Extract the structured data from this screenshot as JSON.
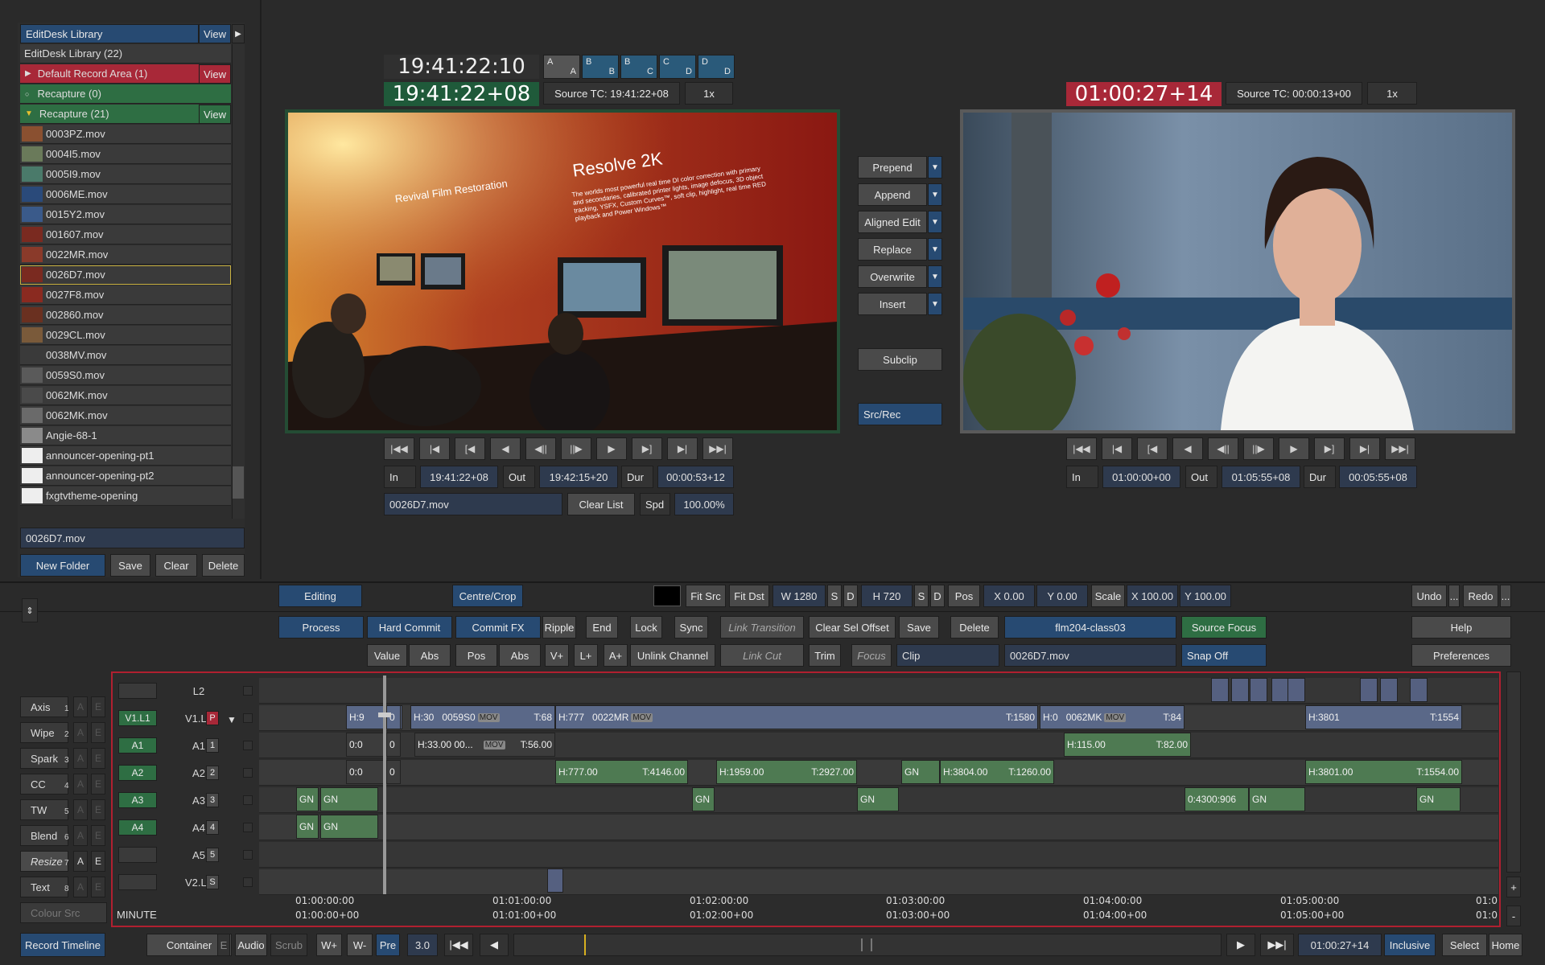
{
  "library": {
    "header": "EditDesk Library",
    "view_label": "View",
    "count_label": "EditDesk Library (22)",
    "default_record": "Default Record Area (1)",
    "recapture_0": "Recapture (0)",
    "recapture_21": "Recapture (21)",
    "items": [
      "0003PZ.mov",
      "0004I5.mov",
      "0005I9.mov",
      "0006ME.mov",
      "0015Y2.mov",
      "001607.mov",
      "0022MR.mov",
      "0026D7.mov",
      "0027F8.mov",
      "002860.mov",
      "0029CL.mov",
      "0038MV.mov",
      "0059S0.mov",
      "0062MK.mov",
      "0062MK.mov",
      "Angie-68-1",
      "announcer-opening-pt1",
      "announcer-opening-pt2",
      "fxgtvtheme-opening"
    ],
    "selected_name": "0026D7.mov",
    "buttons": {
      "new_folder": "New Folder",
      "save": "Save",
      "clear": "Clear",
      "delete": "Delete"
    }
  },
  "source": {
    "tc_top": "19:41:22:10",
    "tc_main": "19:41:22+08",
    "source_tc": "Source TC: 19:41:22+08",
    "speed": "1x",
    "tabs": [
      [
        "A",
        "A"
      ],
      [
        "B",
        "B"
      ],
      [
        "B",
        "C"
      ],
      [
        "C",
        "D"
      ],
      [
        "D",
        "D"
      ]
    ],
    "in_label": "In",
    "in_value": "19:41:22+08",
    "out_label": "Out",
    "out_value": "19:42:15+20",
    "dur_label": "Dur",
    "dur_value": "00:00:53+12",
    "clip_name": "0026D7.mov",
    "clear_list": "Clear List",
    "spd_label": "Spd",
    "spd_value": "100.00%",
    "image_text": {
      "headline": "Resolve 2K",
      "body": "The worlds most powerful real time DI color correction with primary and secondaries, calibrated printer lights, image defocus, 3D object tracking, YSFX, Custom Curves™, soft clip, highlight, real time RED playback and Power Windows™",
      "sign": "Revival Film Restoration"
    }
  },
  "record": {
    "tc_main": "01:00:27+14",
    "source_tc": "Source TC: 00:00:13+00",
    "speed": "1x",
    "in_label": "In",
    "in_value": "01:00:00+00",
    "out_label": "Out",
    "out_value": "01:05:55+08",
    "dur_label": "Dur",
    "dur_value": "00:05:55+08"
  },
  "edit_ops": [
    "Prepend",
    "Append",
    "Aligned Edit",
    "Replace",
    "Overwrite",
    "Insert"
  ],
  "subclip": "Subclip",
  "src_rec": "Src/Rec",
  "toolbar": {
    "editing": "Editing",
    "centre_crop": "Centre/Crop",
    "fit_src": "Fit Src",
    "fit_dst": "Fit Dst",
    "w": "W 1280",
    "s": "S",
    "d": "D",
    "h": "H 720",
    "pos": "Pos",
    "x": "X 0.00",
    "y": "Y 0.00",
    "scale": "Scale",
    "sx": "X 100.00",
    "sy": "Y 100.00",
    "undo": "Undo",
    "redo": "Redo",
    "more": "...",
    "process": "Process",
    "hard_commit": "Hard Commit",
    "commit_fx": "Commit FX",
    "ripple": "Ripple",
    "end": "End",
    "lock": "Lock",
    "sync": "Sync",
    "link_transition": "Link Transition",
    "clear_sel_offset": "Clear Sel Offset",
    "save": "Save",
    "delete": "Delete",
    "clip_library": "flm204-class03",
    "source_focus": "Source Focus",
    "help": "Help",
    "value": "Value",
    "abs": "Abs",
    "pos2": "Pos",
    "abs2": "Abs",
    "vplus": "V+",
    "lplus": "L+",
    "aplus": "A+",
    "unlink": "Unlink Channel",
    "link_cut": "Link Cut",
    "trim": "Trim",
    "focus": "Focus",
    "clip": "Clip",
    "clip_name": "0026D7.mov",
    "snap": "Snap Off",
    "preferences": "Preferences"
  },
  "fx": [
    "Axis",
    "Wipe",
    "Spark",
    "CC",
    "TW",
    "Blend",
    "Resize",
    "Text",
    "Colour Src"
  ],
  "fx_nums": [
    "1",
    "2",
    "3",
    "4",
    "5",
    "6",
    "7",
    "8"
  ],
  "tracks": [
    {
      "src": "",
      "rec": "L2",
      "num": ""
    },
    {
      "src": "V1.L1",
      "rec": "V1.L1",
      "num": "P"
    },
    {
      "src": "A1",
      "rec": "A1",
      "num": "1"
    },
    {
      "src": "A2",
      "rec": "A2",
      "num": "2"
    },
    {
      "src": "A3",
      "rec": "A3",
      "num": "3"
    },
    {
      "src": "A4",
      "rec": "A4",
      "num": "4"
    },
    {
      "src": "",
      "rec": "A5",
      "num": "5"
    },
    {
      "src": "",
      "rec": "V2.L1",
      "num": "S"
    }
  ],
  "clips": {
    "v_h9": "H:9",
    "v_0": "0",
    "v_h30": "H:30",
    "v_0059": "0059S0",
    "v_t68": "T:68",
    "v_h777": "H:777",
    "v_0022": "0022MR",
    "v_t1580": "T:1580",
    "v_h0": "H:0",
    "v_0062": "0062MK",
    "v_t84": "T:84",
    "v_h3801": "H:3801",
    "v_t1554": "T:1554",
    "mov": "MOV",
    "a1_00": "0:0",
    "a1_0": "0",
    "a1_h33": "H:33.00 00...",
    "a1_t56": "T:56.00",
    "a1_h115": "H:115.00",
    "a1_t82": "T:82.00",
    "a2_00": "0:0",
    "a2_0": "0",
    "a2_h777": "H:777.00",
    "a2_t4146": "T:4146.00",
    "a2_h1959": "H:1959.00",
    "a2_t2927": "T:2927.00",
    "gn": "GN",
    "a2_h3804": "H:3804.00",
    "a2_t1260": "T:1260.00",
    "a2_h3801": "H:3801.00",
    "a2_t1554": "T:1554.00",
    "a3_0430": "0:4300:906"
  },
  "ruler": {
    "top": [
      "01:00:00:00",
      "01:01:00:00",
      "01:02:00:00",
      "01:03:00:00",
      "01:04:00:00",
      "01:05:00:00",
      "01:0"
    ],
    "bottom": [
      "01:00:00+00",
      "01:01:00+00",
      "01:02:00+00",
      "01:03:00+00",
      "01:04:00+00",
      "01:05:00+00",
      "01:0"
    ],
    "unit": "MINUTE"
  },
  "bottom": {
    "record_timeline": "Record Timeline",
    "container": "Container",
    "e": "E",
    "audio": "Audio",
    "scrub": "Scrub",
    "wplus": "W+",
    "wminus": "W-",
    "pre": "Pre",
    "pre_value": "3.0",
    "tc": "01:00:27+14",
    "inclusive": "Inclusive",
    "select": "Select",
    "home": "Home"
  },
  "colors": {
    "accent_blue": "#274a72",
    "green": "#2e6e43",
    "red": "#b02838",
    "timeline_border": "#b02030"
  }
}
